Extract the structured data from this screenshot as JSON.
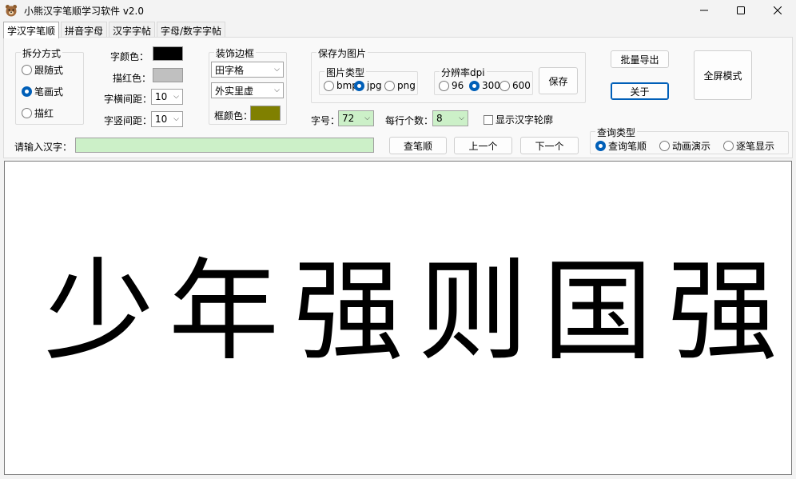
{
  "window": {
    "title": "小熊汉字笔顺学习软件 v2.0"
  },
  "tabs": [
    {
      "label": "学汉字笔顺",
      "active": true
    },
    {
      "label": "拼音字母",
      "active": false
    },
    {
      "label": "汉字字帖",
      "active": false
    },
    {
      "label": "字母/数字字帖",
      "active": false
    }
  ],
  "split_mode": {
    "legend": "拆分方式",
    "options": [
      {
        "label": "跟随式",
        "selected": false
      },
      {
        "label": "笔画式",
        "selected": true
      },
      {
        "label": "描红",
        "selected": false
      }
    ]
  },
  "style": {
    "font_color_label": "字颜色：",
    "font_color": "#000000",
    "trace_color_label": "描红色：",
    "trace_color": "#c0c0c0",
    "h_spacing_label": "字横间距：",
    "h_spacing": "10",
    "v_spacing_label": "字竖间距：",
    "v_spacing": "10"
  },
  "border": {
    "legend": "装饰边框",
    "grid_type": "田字格",
    "line_style": "外实里虚",
    "frame_color_label": "框颜色：",
    "frame_color": "#808000"
  },
  "save_image": {
    "legend": "保存为图片",
    "type_legend": "图片类型",
    "types": [
      {
        "label": "bmp",
        "selected": false
      },
      {
        "label": "jpg",
        "selected": true
      },
      {
        "label": "png",
        "selected": false
      }
    ],
    "dpi_legend": "分辨率dpi",
    "dpis": [
      {
        "label": "96",
        "selected": false
      },
      {
        "label": "300",
        "selected": true
      },
      {
        "label": "600",
        "selected": false
      }
    ],
    "save_label": "保存"
  },
  "font_size_label": "字号：",
  "font_size": "72",
  "per_row_label": "每行个数：",
  "per_row": "8",
  "show_outline_label": "显示汉字轮廓",
  "buttons": {
    "batch_export": "批量导出",
    "about": "关于",
    "fullscreen": "全屏模式",
    "lookup": "查笔顺",
    "prev": "上一个",
    "next": "下一个"
  },
  "input": {
    "label": "请输入汉字：",
    "value": ""
  },
  "query_type": {
    "legend": "查询类型",
    "options": [
      {
        "label": "查询笔顺",
        "selected": true
      },
      {
        "label": "动画演示",
        "selected": false
      },
      {
        "label": "逐笔显示",
        "selected": false
      }
    ]
  },
  "display_chars": [
    "少",
    "年",
    "强",
    "则",
    "国",
    "强"
  ]
}
